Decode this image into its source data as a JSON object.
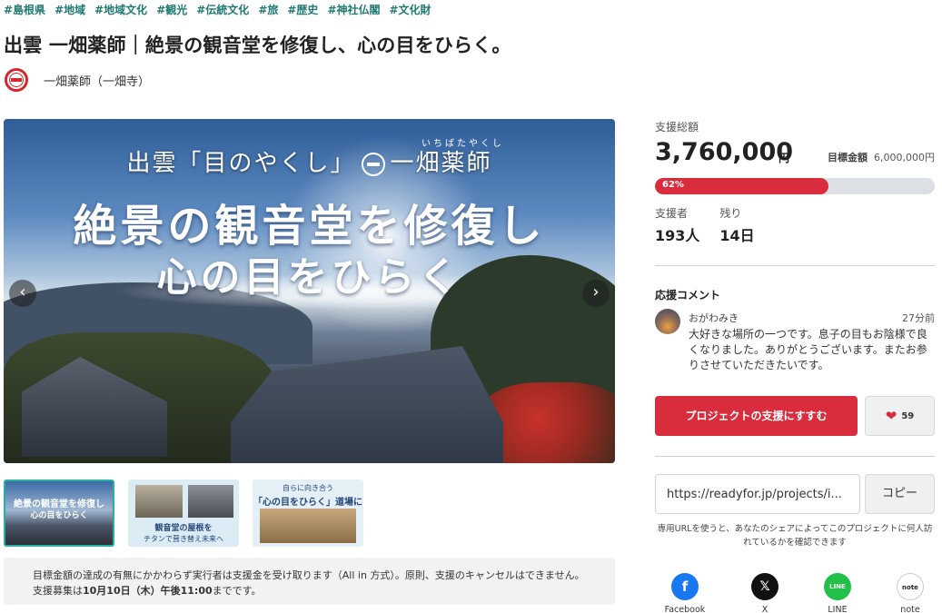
{
  "tags": [
    "#島根県",
    "#地域",
    "#地域文化",
    "#観光",
    "#伝統文化",
    "#旅",
    "#歴史",
    "#神社仏閣",
    "#文化財"
  ],
  "title": "出雲 一畑薬師｜絶景の観音堂を修復し、心の目をひらく。",
  "owner": {
    "name": "一畑薬師（一畑寺）"
  },
  "hero": {
    "subtitle_left": "出雲「目のやくし」",
    "subtitle_right": "一畑薬師",
    "ruby": "いちばたやくし",
    "main_line1": "絶景の観音堂を修復し",
    "main_line2": "心の目をひらく",
    "prev_icon": "‹",
    "next_icon": "›"
  },
  "thumbs": {
    "t1_line1": "絶景の観音堂を修復し",
    "t1_line2": "心の目をひらく",
    "t2_line1": "観音堂の屋根を",
    "t2_line2": "チタンで葺き替え未来へ",
    "t3_line1": "自らに向き合う",
    "t3_line2": "「心の目をひらく」道場に"
  },
  "notice": {
    "text1": "目標金額の達成の有無にかかわらず実行者は支援金を受け取ります（All in 方式）。原則、支援のキャンセルはできません。支援募集は",
    "deadline": "10月10日（木）午後11:00",
    "text2": "までです。"
  },
  "funding": {
    "total_label": "支援総額",
    "total": "3,760,000",
    "unit": "円",
    "target_label": "目標金額",
    "target": "6,000,000円",
    "percent_text": "62%",
    "percent": 62,
    "supporters_label": "支援者",
    "supporters": "193人",
    "remaining_label": "残り",
    "remaining": "14日"
  },
  "comments": {
    "title": "応援コメント",
    "user": "おがわみき",
    "time": "27分前",
    "body": "大好きな場所の一つです。息子の目もお陰様で良くなりました。ありがとうございます。またお参りさせていただきたいです。"
  },
  "actions": {
    "support_label": "プロジェクトの支援にすすむ",
    "like_count": "59",
    "share_url": "https://readyfor.jp/projects/i...",
    "copy_label": "コピー",
    "share_note": "専用URLを使うと、あなたのシェアによってこのプロジェクトに何人訪れているかを確認できます"
  },
  "share": {
    "facebook_glyph": "f",
    "facebook_label": "Facebook",
    "x_glyph": "𝕏",
    "x_label": "X",
    "line_glyph": "LINE",
    "line_label": "LINE",
    "note_glyph": "note",
    "note_label": "note"
  },
  "colors": {
    "accent": "#d92c3c",
    "tag": "#1f7a72",
    "progress_bg": "#dcdfe3"
  }
}
